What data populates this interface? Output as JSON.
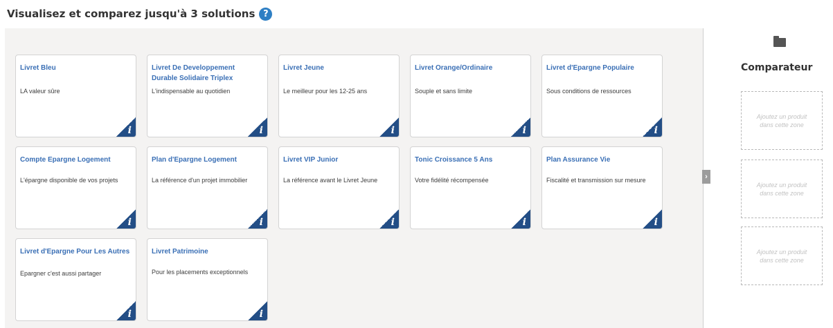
{
  "header": {
    "title": "Visualisez et comparez jusqu'à 3 solutions",
    "help_glyph": "?"
  },
  "products": [
    {
      "title": "Livret Bleu",
      "description": "LA valeur sûre"
    },
    {
      "title": "Livret De Developpement Durable Solidaire Triplex",
      "description": "L'indispensable au quotidien"
    },
    {
      "title": "Livret Jeune",
      "description": "Le meilleur pour les 12-25 ans"
    },
    {
      "title": "Livret Orange/Ordinaire",
      "description": "Souple et sans limite"
    },
    {
      "title": "Livret d'Epargne Populaire",
      "description": "Sous conditions de ressources"
    },
    {
      "title": "Compte Epargne Logement",
      "description": "L'épargne disponible de vos projets"
    },
    {
      "title": "Plan d'Epargne Logement",
      "description": "La référence d'un projet immobilier"
    },
    {
      "title": "Livret VIP Junior",
      "description": "La référence avant le Livret Jeune"
    },
    {
      "title": "Tonic Croissance 5 Ans",
      "description": "Votre fidélité récompensée"
    },
    {
      "title": "Plan Assurance Vie",
      "description": "Fiscalité et transmission sur mesure"
    },
    {
      "title": "Livret d'Epargne Pour Les Autres",
      "description": "Epargner c'est aussi partager"
    },
    {
      "title": "Livret Patrimoine",
      "description": "Pour les placements exceptionnels"
    }
  ],
  "info_glyph": "i",
  "collapse_handle": {
    "glyph": "›"
  },
  "sidebar": {
    "icon": "folder-icon",
    "title": "Comparateur",
    "drop_zones": [
      {
        "text": "Ajoutez un produit dans cette zone"
      },
      {
        "text": "Ajoutez un produit dans cette zone"
      },
      {
        "text": "Ajoutez un produit dans cette zone"
      }
    ]
  },
  "colors": {
    "accent": "#2e7fc4",
    "card_title": "#3a6fb5",
    "info_badge": "#234e86",
    "panel_bg": "#f4f3f2"
  }
}
